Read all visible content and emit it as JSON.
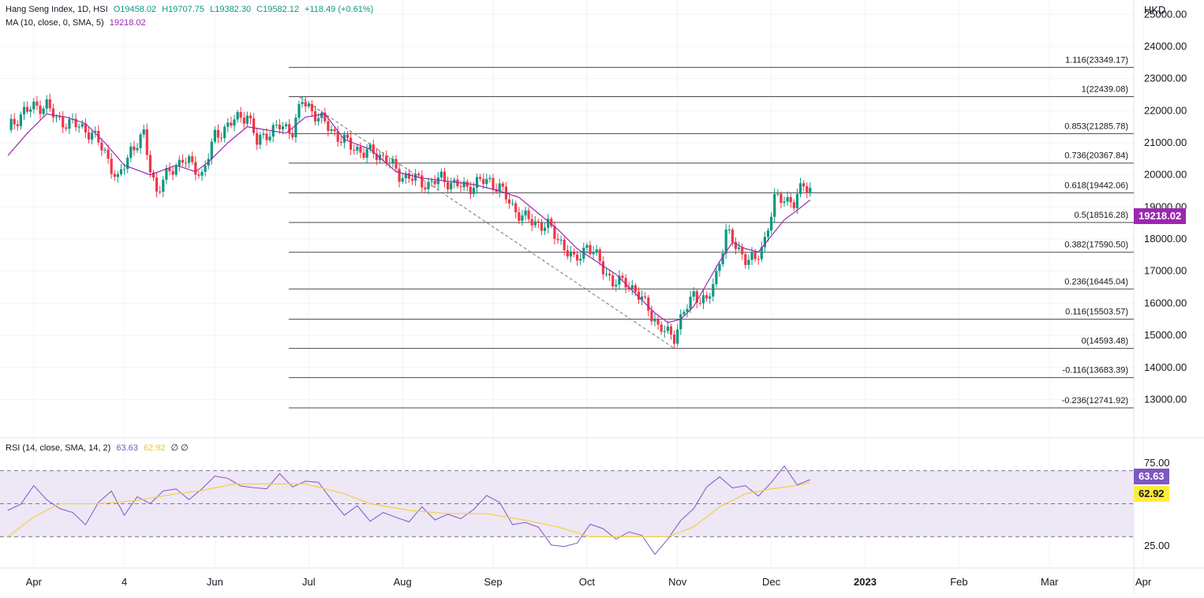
{
  "legend": {
    "symbol": "Hang Seng Index, 1D, HSI",
    "open": "O19458.02",
    "high": "H19707.75",
    "low": "L19382.30",
    "close": "C19582.12",
    "change": "+118.49 (+0.61%)",
    "ma_label": "MA (10, close, 0, SMA, 5)",
    "ma_value": "19218.02",
    "rsi_label": "RSI (14, close, SMA, 14, 2)",
    "rsi_value": "63.63",
    "rsi_ma_value": "62.92",
    "rsi_extra": "∅ ∅"
  },
  "currency": "HKD",
  "colors": {
    "up": "#089981",
    "down": "#f23645",
    "ma": "#9c27b0",
    "rsi": "#7e57c2",
    "rsi_ma": "#f4d03f",
    "rsi_band": "#ede7f6",
    "grid": "#f0f3fa",
    "fib_line": "#4a4a4a"
  },
  "price_tag": {
    "text": "19218.02",
    "color": "#9c27b0"
  },
  "rsi_tags": [
    {
      "text": "63.63",
      "bg": "#7e57c2",
      "fg": "#ffffff"
    },
    {
      "text": "62.92",
      "bg": "#ffeb3b",
      "fg": "#131722"
    }
  ],
  "chart_data": [
    {
      "type": "candlestick",
      "title": "Hang Seng Index, 1D, HSI",
      "y_axis_ticks": [
        "25000.00",
        "24000.00",
        "23000.00",
        "22000.00",
        "21000.00",
        "20000.00",
        "19000.00",
        "18000.00",
        "17000.00",
        "16000.00",
        "15000.00",
        "14000.00",
        "13000.00"
      ],
      "ylim": [
        12200,
        25400
      ],
      "x_axis_ticks": [
        "Apr",
        "4",
        "Jun",
        "Jul",
        "Aug",
        "Sep",
        "Oct",
        "Nov",
        "Dec",
        "2023",
        "Feb",
        "Mar",
        "Apr"
      ],
      "x_tick_index": [
        8,
        36,
        64,
        93,
        122,
        150,
        179,
        207,
        236,
        265,
        294,
        322,
        351
      ],
      "fib_levels": [
        {
          "label": "1.116(23349.17)",
          "value": 23349.17
        },
        {
          "label": "1(22439.08)",
          "value": 22439.08
        },
        {
          "label": "0.853(21285.78)",
          "value": 21285.78
        },
        {
          "label": "0.736(20367.84)",
          "value": 20367.84
        },
        {
          "label": "0.618(19442.06)",
          "value": 19442.06
        },
        {
          "label": "0.5(18516.28)",
          "value": 18516.28
        },
        {
          "label": "0.382(17590.50)",
          "value": 17590.5
        },
        {
          "label": "0.236(16445.04)",
          "value": 16445.04
        },
        {
          "label": "0.116(15503.57)",
          "value": 15503.57
        },
        {
          "label": "0(14593.48)",
          "value": 14593.48
        },
        {
          "label": "-0.116(13683.39)",
          "value": -13683.39
        },
        {
          "label": "-0.236(12741.92)",
          "value": -12741.92
        }
      ],
      "fib_trend": {
        "from": [
          90,
          22439
        ],
        "to": [
          206,
          14593
        ]
      },
      "close_path": [
        [
          0,
          21400
        ],
        [
          5,
          22000
        ],
        [
          12,
          22200
        ],
        [
          15,
          21700
        ],
        [
          20,
          21600
        ],
        [
          26,
          21300
        ],
        [
          30,
          20700
        ],
        [
          34,
          19800
        ],
        [
          38,
          20800
        ],
        [
          42,
          21200
        ],
        [
          44,
          20200
        ],
        [
          46,
          19500
        ],
        [
          50,
          20100
        ],
        [
          54,
          20500
        ],
        [
          58,
          20200
        ],
        [
          60,
          20000
        ],
        [
          64,
          21200
        ],
        [
          70,
          21700
        ],
        [
          74,
          21900
        ],
        [
          77,
          21000
        ],
        [
          80,
          21300
        ],
        [
          84,
          21500
        ],
        [
          88,
          21400
        ],
        [
          91,
          22300
        ],
        [
          95,
          21900
        ],
        [
          99,
          21500
        ],
        [
          102,
          21200
        ],
        [
          106,
          20900
        ],
        [
          110,
          20700
        ],
        [
          113,
          20700
        ],
        [
          117,
          20500
        ],
        [
          121,
          20000
        ],
        [
          125,
          19900
        ],
        [
          130,
          19700
        ],
        [
          134,
          19900
        ],
        [
          138,
          19700
        ],
        [
          142,
          19600
        ],
        [
          146,
          19800
        ],
        [
          149,
          19800
        ],
        [
          152,
          19600
        ],
        [
          156,
          19000
        ],
        [
          159,
          18700
        ],
        [
          163,
          18500
        ],
        [
          167,
          18400
        ],
        [
          171,
          17900
        ],
        [
          175,
          17300
        ],
        [
          179,
          17800
        ],
        [
          183,
          17300
        ],
        [
          187,
          16600
        ],
        [
          191,
          16700
        ],
        [
          195,
          16200
        ],
        [
          198,
          15900
        ],
        [
          201,
          15200
        ],
        [
          204,
          15100
        ],
        [
          206,
          15000
        ],
        [
          209,
          15700
        ],
        [
          212,
          16300
        ],
        [
          216,
          16000
        ],
        [
          219,
          16900
        ],
        [
          222,
          18200
        ],
        [
          225,
          17800
        ],
        [
          228,
          17400
        ],
        [
          231,
          17300
        ],
        [
          234,
          18000
        ],
        [
          237,
          19200
        ],
        [
          240,
          19300
        ],
        [
          243,
          19100
        ],
        [
          246,
          19700
        ],
        [
          248,
          19582
        ]
      ],
      "ma_values": [
        [
          0,
          20600
        ],
        [
          6,
          21300
        ],
        [
          12,
          21900
        ],
        [
          18,
          21800
        ],
        [
          24,
          21600
        ],
        [
          30,
          21000
        ],
        [
          36,
          20300
        ],
        [
          44,
          20000
        ],
        [
          52,
          20300
        ],
        [
          58,
          20100
        ],
        [
          62,
          20400
        ],
        [
          68,
          21000
        ],
        [
          74,
          21500
        ],
        [
          80,
          21400
        ],
        [
          86,
          21300
        ],
        [
          92,
          21800
        ],
        [
          98,
          21900
        ],
        [
          104,
          21100
        ],
        [
          112,
          20800
        ],
        [
          120,
          20100
        ],
        [
          128,
          19900
        ],
        [
          136,
          19800
        ],
        [
          144,
          19700
        ],
        [
          152,
          19500
        ],
        [
          158,
          19300
        ],
        [
          164,
          18800
        ],
        [
          170,
          18300
        ],
        [
          176,
          17700
        ],
        [
          182,
          17300
        ],
        [
          188,
          16900
        ],
        [
          194,
          16300
        ],
        [
          200,
          15700
        ],
        [
          204,
          15400
        ],
        [
          208,
          15500
        ],
        [
          212,
          15900
        ],
        [
          216,
          16600
        ],
        [
          220,
          17300
        ],
        [
          224,
          17900
        ],
        [
          228,
          17700
        ],
        [
          232,
          17600
        ],
        [
          236,
          18100
        ],
        [
          240,
          18600
        ],
        [
          244,
          18900
        ],
        [
          248,
          19218
        ]
      ]
    },
    {
      "type": "line",
      "title": "RSI (14, close, SMA, 14, 2)",
      "y_axis_ticks": [
        "75.00",
        "25.00"
      ],
      "ylim": [
        13,
        87
      ],
      "bands": [
        70,
        50,
        30
      ],
      "rsi": [
        [
          0,
          46
        ],
        [
          4,
          52
        ],
        [
          8,
          58
        ],
        [
          12,
          54
        ],
        [
          16,
          48
        ],
        [
          20,
          42
        ],
        [
          24,
          40
        ],
        [
          28,
          50
        ],
        [
          32,
          56
        ],
        [
          36,
          46
        ],
        [
          40,
          52
        ],
        [
          44,
          50
        ],
        [
          48,
          60
        ],
        [
          52,
          56
        ],
        [
          56,
          54
        ],
        [
          60,
          60
        ],
        [
          64,
          64
        ],
        [
          68,
          68
        ],
        [
          72,
          60
        ],
        [
          76,
          58
        ],
        [
          80,
          62
        ],
        [
          84,
          66
        ],
        [
          88,
          60
        ],
        [
          92,
          66
        ],
        [
          96,
          60
        ],
        [
          100,
          54
        ],
        [
          104,
          44
        ],
        [
          108,
          46
        ],
        [
          112,
          42
        ],
        [
          116,
          44
        ],
        [
          120,
          40
        ],
        [
          124,
          42
        ],
        [
          128,
          46
        ],
        [
          132,
          40
        ],
        [
          136,
          46
        ],
        [
          140,
          38
        ],
        [
          144,
          48
        ],
        [
          148,
          56
        ],
        [
          152,
          48
        ],
        [
          156,
          40
        ],
        [
          160,
          38
        ],
        [
          164,
          34
        ],
        [
          168,
          28
        ],
        [
          172,
          22
        ],
        [
          176,
          26
        ],
        [
          180,
          40
        ],
        [
          184,
          32
        ],
        [
          188,
          30
        ],
        [
          192,
          34
        ],
        [
          196,
          28
        ],
        [
          200,
          22
        ],
        [
          204,
          28
        ],
        [
          208,
          38
        ],
        [
          212,
          50
        ],
        [
          216,
          58
        ],
        [
          220,
          66
        ],
        [
          224,
          62
        ],
        [
          228,
          58
        ],
        [
          232,
          56
        ],
        [
          236,
          64
        ],
        [
          240,
          70
        ],
        [
          244,
          64
        ],
        [
          248,
          64
        ]
      ],
      "rsi_ma": [
        [
          0,
          30
        ],
        [
          8,
          42
        ],
        [
          16,
          50
        ],
        [
          28,
          50
        ],
        [
          40,
          52
        ],
        [
          52,
          56
        ],
        [
          60,
          58
        ],
        [
          70,
          62
        ],
        [
          80,
          62
        ],
        [
          92,
          62
        ],
        [
          104,
          56
        ],
        [
          112,
          50
        ],
        [
          124,
          46
        ],
        [
          136,
          44
        ],
        [
          148,
          44
        ],
        [
          160,
          40
        ],
        [
          170,
          36
        ],
        [
          180,
          30
        ],
        [
          192,
          30
        ],
        [
          204,
          30
        ],
        [
          212,
          36
        ],
        [
          220,
          48
        ],
        [
          228,
          56
        ],
        [
          236,
          59
        ],
        [
          244,
          61
        ],
        [
          248,
          63
        ]
      ]
    }
  ]
}
